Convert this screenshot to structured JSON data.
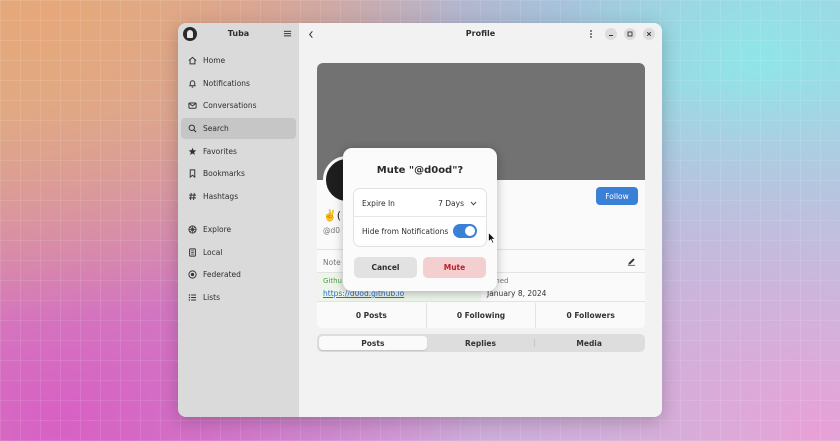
{
  "sidebar": {
    "app_title": "Tuba",
    "items": [
      {
        "label": "Home",
        "icon": "home-icon"
      },
      {
        "label": "Notifications",
        "icon": "bell-icon"
      },
      {
        "label": "Conversations",
        "icon": "envelope-icon"
      },
      {
        "label": "Search",
        "icon": "search-icon",
        "active": true
      },
      {
        "label": "Favorites",
        "icon": "star-icon"
      },
      {
        "label": "Bookmarks",
        "icon": "bookmark-icon"
      },
      {
        "label": "Hashtags",
        "icon": "hashtag-icon"
      },
      {
        "label": "Explore",
        "icon": "compass-icon"
      },
      {
        "label": "Local",
        "icon": "building-icon"
      },
      {
        "label": "Federated",
        "icon": "globe-icon"
      },
      {
        "label": "Lists",
        "icon": "list-icon"
      }
    ]
  },
  "main": {
    "page_title": "Profile",
    "profile": {
      "display_name": "✌️(",
      "handle": "@d0",
      "follow_label": "Follow",
      "note_label": "Note",
      "field_left_key": "Githu",
      "field_left_value": "https://d0od.github.io",
      "field_right_key": "Joined",
      "field_right_value": "January 8, 2024",
      "stats": [
        "0 Posts",
        "0 Following",
        "0 Followers"
      ]
    },
    "tabs": [
      "Posts",
      "Replies",
      "Media"
    ],
    "active_tab": "Posts"
  },
  "dialog": {
    "title": "Mute \"@d0od\"?",
    "expire_label": "Expire In",
    "expire_value": "7 Days",
    "hide_label": "Hide from Notifications",
    "hide_enabled": true,
    "cancel_label": "Cancel",
    "mute_label": "Mute"
  },
  "colors": {
    "accent": "#3a80d6",
    "destructive": "#c01c28",
    "destructive_bg": "#f4cfd0"
  }
}
